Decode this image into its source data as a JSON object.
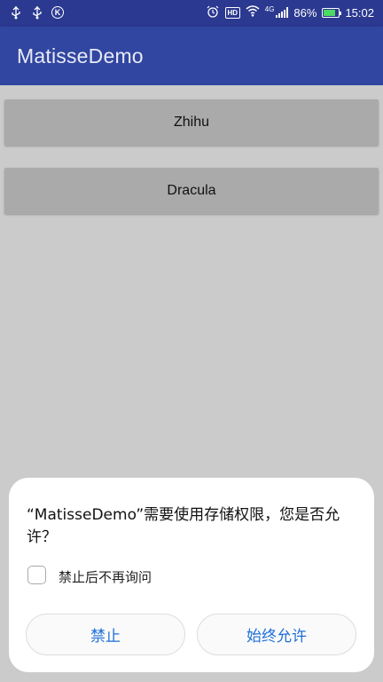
{
  "status_bar": {
    "left_icons": [
      "usb-icon",
      "usb-debug-icon",
      "k-icon"
    ],
    "k_glyph": "K",
    "hd_label": "HD",
    "network_type": "4G",
    "battery": "86%",
    "battery_level": 0.86,
    "time": "15:02"
  },
  "app_bar": {
    "title": "MatisseDemo"
  },
  "buttons": [
    {
      "label": "Zhihu"
    },
    {
      "label": "Dracula"
    }
  ],
  "permission_dialog": {
    "message": "“MatisseDemo”需要使用存储权限，您是否允许？",
    "checkbox_label": "禁止后不再询问",
    "checkbox_checked": false,
    "deny_label": "禁止",
    "allow_label": "始终允许"
  },
  "colors": {
    "status_bar": "#2b3990",
    "app_bar": "#3146a0",
    "background": "#cbcbcb",
    "button": "#a9aaa9",
    "dialog_accent": "#1e6fd9",
    "battery_fill": "#4cd964"
  }
}
